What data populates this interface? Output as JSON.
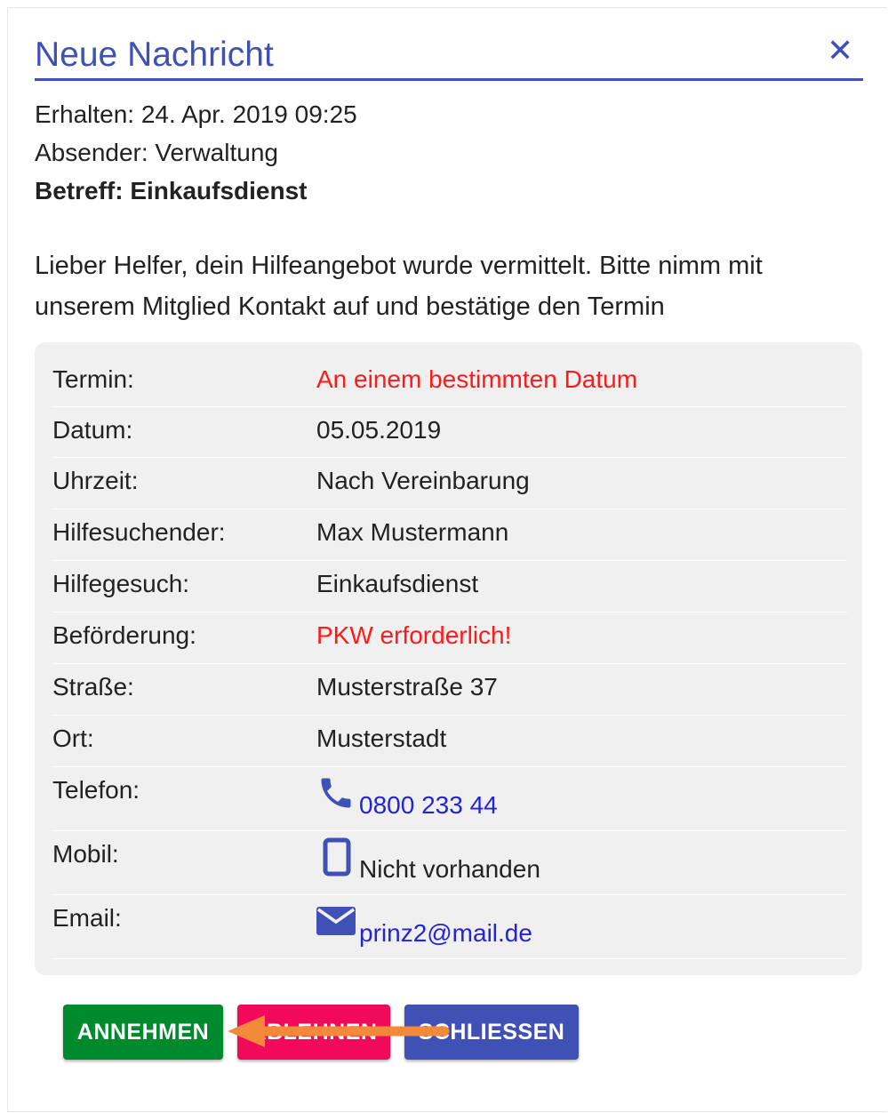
{
  "dialog": {
    "title": "Neue Nachricht",
    "close_icon": "close-icon"
  },
  "meta": {
    "received": "Erhalten: 24. Apr. 2019 09:25",
    "sender": "Absender: Verwaltung",
    "subject": "Betreff: Einkaufsdienst"
  },
  "message": "Lieber Helfer, dein Hilfeangebot wurde vermittelt. Bitte nimm mit unserem Mitglied Kontakt auf und bestätige den Termin",
  "details": [
    {
      "label": "Termin:",
      "value": "An einem bestimmten Datum"
    },
    {
      "label": "Datum:",
      "value": "05.05.2019"
    },
    {
      "label": "Uhrzeit:",
      "value": "Nach Vereinbarung"
    },
    {
      "label": "Hilfesuchender:",
      "value": "Max Mustermann"
    },
    {
      "label": "Hilfegesuch:",
      "value": "Einkaufsdienst"
    },
    {
      "label": "Beförderung:",
      "value": "PKW erforderlich!"
    },
    {
      "label": "Straße:",
      "value": "Musterstraße 37"
    },
    {
      "label": "Ort:",
      "value": "Musterstadt"
    },
    {
      "label": "Telefon:",
      "value": "0800 233 44",
      "icon": "phone-icon"
    },
    {
      "label": "Mobil:",
      "value": "Nicht vorhanden",
      "icon": "mobile-icon"
    },
    {
      "label": "Email:",
      "value": "prinz2@mail.de",
      "icon": "envelope-icon"
    }
  ],
  "buttons": {
    "accept": "ANNEHMEN",
    "decline": "ABLEHNEN",
    "close": "SCHLIESSEN"
  },
  "colors": {
    "accent": "#3f51b5",
    "accept": "#008a2e",
    "decline": "#f20a5a",
    "alert": "#ff1a1a",
    "link": "#2323d8",
    "annotation_arrow": "#f28a3a"
  }
}
